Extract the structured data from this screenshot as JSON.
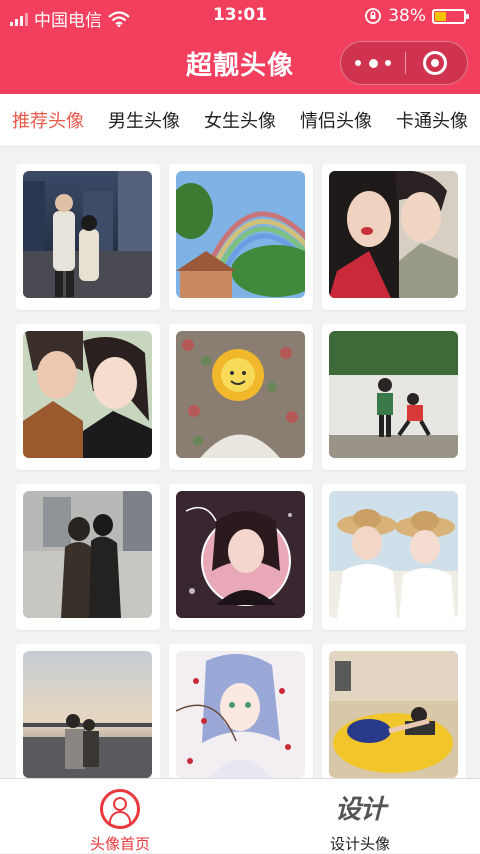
{
  "status_bar": {
    "carrier": "中国电信",
    "time": "13:01",
    "battery": "38%",
    "battery_level": 0.38
  },
  "header": {
    "title": "超靓头像"
  },
  "tabs": [
    {
      "label": "推荐头像",
      "active": true
    },
    {
      "label": "男生头像",
      "active": false
    },
    {
      "label": "女生头像",
      "active": false
    },
    {
      "label": "情侣头像",
      "active": false
    },
    {
      "label": "卡通头像",
      "active": false
    }
  ],
  "grid": {
    "items": [
      {
        "icon": "photo-couple-city-night"
      },
      {
        "icon": "photo-rainbow-sky"
      },
      {
        "icon": "photo-couple-selfie"
      },
      {
        "icon": "photo-couple-closeup"
      },
      {
        "icon": "photo-girl-sunflower-sign"
      },
      {
        "icon": "photo-couple-wall"
      },
      {
        "icon": "photo-couple-silhouette"
      },
      {
        "icon": "photo-girl-pink-circle"
      },
      {
        "icon": "photo-couple-straw-hats"
      },
      {
        "icon": "photo-couple-sunset"
      },
      {
        "icon": "photo-anime-girl-blossoms"
      },
      {
        "icon": "photo-couple-yellow-sofa"
      }
    ]
  },
  "tabbar": {
    "home_label": "头像首页",
    "design_label": "设计头像",
    "design_icon_text": "设计"
  },
  "colors": {
    "brand": "#f23f5e",
    "active_tab": "#e8594a",
    "tabbar_active": "#e8383d"
  }
}
